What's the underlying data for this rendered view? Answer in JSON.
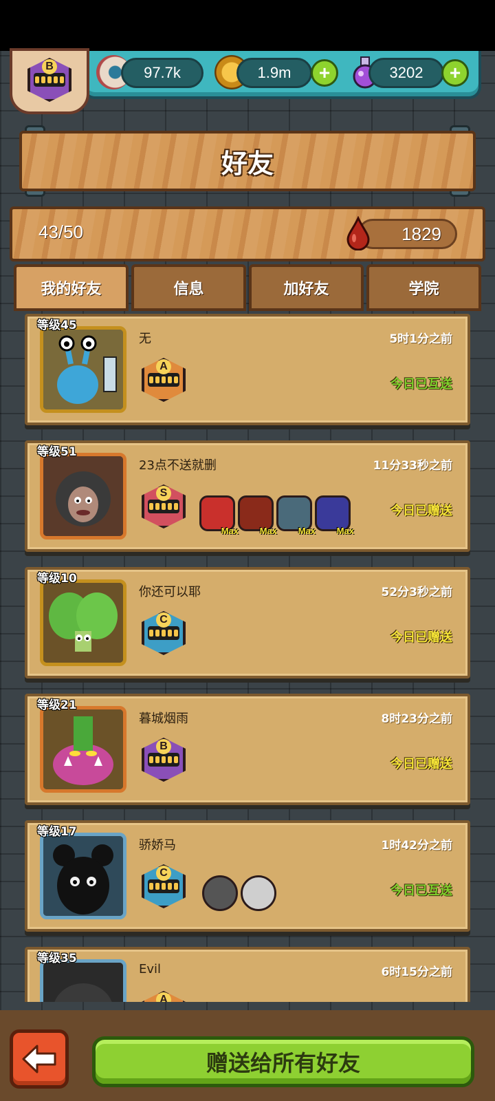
{
  "player": {
    "rank": "B"
  },
  "resources": {
    "eyeball": {
      "value": "97.7k",
      "icon": "eyeball-icon"
    },
    "coins": {
      "value": "1.9m",
      "icon": "coin-icon"
    },
    "potion": {
      "value": "3202",
      "icon": "potion-icon"
    }
  },
  "title": "好友",
  "friend_count": "43/50",
  "blood": {
    "value": "1829",
    "icon": "blood-drop-icon"
  },
  "tabs": [
    {
      "label": "我的好友",
      "active": true
    },
    {
      "label": "信息",
      "active": false
    },
    {
      "label": "加好友",
      "active": false
    },
    {
      "label": "学院",
      "active": false
    }
  ],
  "friends": [
    {
      "level": "等级45",
      "name": "无",
      "time": "5时1分之前",
      "status": "今日已互送",
      "status_color": "green",
      "rank": "A",
      "pets": []
    },
    {
      "level": "等级51",
      "name": "23点不送就删",
      "time": "11分33秒之前",
      "status": "今日已赠送",
      "status_color": "yellow",
      "rank": "S",
      "pets": [
        "Max",
        "Max",
        "Max",
        "Max"
      ]
    },
    {
      "level": "等级10",
      "name": "你还可以耶",
      "time": "52分3秒之前",
      "status": "今日已赠送",
      "status_color": "yellow",
      "rank": "C",
      "pets": []
    },
    {
      "level": "等级21",
      "name": "暮城烟雨",
      "time": "8时23分之前",
      "status": "今日已赠送",
      "status_color": "yellow",
      "rank": "B",
      "pets": []
    },
    {
      "level": "等级17",
      "name": "骄娇马",
      "time": "1时42分之前",
      "status": "今日已互送",
      "status_color": "green",
      "rank": "C",
      "pets": [
        "",
        ""
      ]
    },
    {
      "level": "等级35",
      "name": "Evil",
      "time": "6时15分之前",
      "status": "",
      "status_color": "",
      "rank": "A",
      "pets": []
    }
  ],
  "send_all_label": "赠送给所有好友",
  "colors": {
    "accent_green": "#8ed032",
    "back_red": "#e8542c",
    "teal_bar": "#3fb7bf",
    "wood": "#d59a58"
  }
}
